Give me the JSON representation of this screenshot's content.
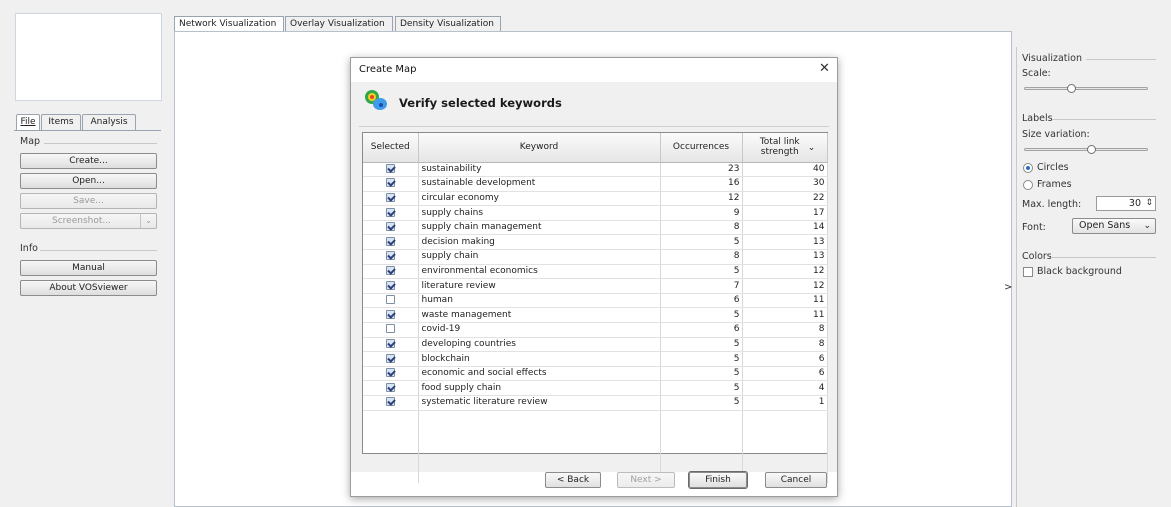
{
  "left_panel": {
    "tabs": [
      "File",
      "Items",
      "Analysis"
    ],
    "map_group": {
      "label": "Map",
      "buttons": [
        {
          "label": "Create...",
          "enabled": true
        },
        {
          "label": "Open...",
          "enabled": true
        },
        {
          "label": "Save...",
          "enabled": false
        },
        {
          "label": "Screenshot...",
          "enabled": false
        }
      ],
      "dropdown_icon": "chevron-down-icon"
    },
    "info_group": {
      "label": "Info",
      "buttons": [
        {
          "label": "Manual",
          "enabled": true
        },
        {
          "label": "About VOSviewer",
          "enabled": true
        }
      ]
    }
  },
  "main": {
    "tabs": [
      "Network Visualization",
      "Overlay Visualization",
      "Density Visualization"
    ],
    "active_tab": "Network Visualization",
    "collapse_glyph": ">"
  },
  "right_panel": {
    "visualization": {
      "label": "Visualization",
      "scale_label": "Scale:",
      "scale_value": 0.5
    },
    "labels": {
      "label": "Labels",
      "size_variation_label": "Size variation:",
      "size_variation_value": 0.5,
      "options": [
        {
          "label": "Circles",
          "selected": true
        },
        {
          "label": "Frames",
          "selected": false
        }
      ],
      "max_length_label": "Max. length:",
      "max_length_value": "30",
      "spinner_glyph": "⇕",
      "font_label": "Font:",
      "font_value": "Open Sans",
      "font_arrow": "⌄"
    },
    "colors": {
      "label": "Colors",
      "black_background_label": "Black background",
      "black_background_checked": false
    }
  },
  "dialog": {
    "title": "Create Map",
    "close_glyph": "✕",
    "heading": "Verify selected keywords",
    "columns": {
      "selected": "Selected",
      "keyword": "Keyword",
      "occurrences": "Occurrences",
      "total_link_strength": "Total link strength"
    },
    "sort_glyph": "⌄",
    "rows": [
      {
        "selected": true,
        "keyword": "sustainability",
        "occurrences": "23",
        "strength": "40"
      },
      {
        "selected": true,
        "keyword": "sustainable development",
        "occurrences": "16",
        "strength": "30"
      },
      {
        "selected": true,
        "keyword": "circular economy",
        "occurrences": "12",
        "strength": "22"
      },
      {
        "selected": true,
        "keyword": "supply chains",
        "occurrences": "9",
        "strength": "17"
      },
      {
        "selected": true,
        "keyword": "supply chain management",
        "occurrences": "8",
        "strength": "14"
      },
      {
        "selected": true,
        "keyword": "decision making",
        "occurrences": "5",
        "strength": "13"
      },
      {
        "selected": true,
        "keyword": "supply chain",
        "occurrences": "8",
        "strength": "13"
      },
      {
        "selected": true,
        "keyword": "environmental economics",
        "occurrences": "5",
        "strength": "12"
      },
      {
        "selected": true,
        "keyword": "literature review",
        "occurrences": "7",
        "strength": "12"
      },
      {
        "selected": false,
        "keyword": "human",
        "occurrences": "6",
        "strength": "11"
      },
      {
        "selected": true,
        "keyword": "waste management",
        "occurrences": "5",
        "strength": "11"
      },
      {
        "selected": false,
        "keyword": "covid-19",
        "occurrences": "6",
        "strength": "8"
      },
      {
        "selected": true,
        "keyword": "developing countries",
        "occurrences": "5",
        "strength": "8"
      },
      {
        "selected": true,
        "keyword": "blockchain",
        "occurrences": "5",
        "strength": "6"
      },
      {
        "selected": true,
        "keyword": "economic and social effects",
        "occurrences": "5",
        "strength": "6"
      },
      {
        "selected": true,
        "keyword": "food supply chain",
        "occurrences": "5",
        "strength": "4"
      },
      {
        "selected": true,
        "keyword": "systematic literature review",
        "occurrences": "5",
        "strength": "1"
      }
    ],
    "buttons": {
      "back": "< Back",
      "next": "Next >",
      "finish": "Finish",
      "cancel": "Cancel"
    }
  }
}
